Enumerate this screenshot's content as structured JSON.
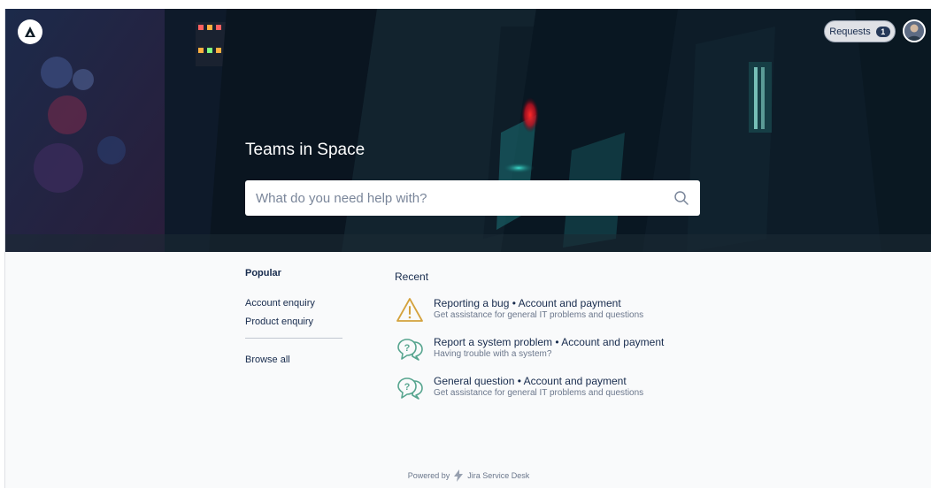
{
  "header": {
    "requests_label": "Requests",
    "requests_count": "1"
  },
  "hero": {
    "title": "Teams in Space",
    "search_placeholder": "What do you need help with?"
  },
  "popular": {
    "heading": "Popular",
    "links": [
      "Account enquiry",
      "Product enquiry"
    ],
    "browse_all": "Browse all"
  },
  "recent": {
    "heading": "Recent",
    "items": [
      {
        "title": "Reporting a bug • Account and payment",
        "description": "Get assistance for general IT problems and questions",
        "icon": "warning-icon"
      },
      {
        "title": "Report a system problem • Account and payment",
        "description": "Having trouble with a system?",
        "icon": "question-bubble-icon"
      },
      {
        "title": "General question • Account and payment",
        "description": "Get assistance for general IT problems and questions",
        "icon": "question-bubble-icon"
      }
    ]
  },
  "footer": {
    "powered_by": "Powered by",
    "product": "Jira Service Desk"
  },
  "colors": {
    "warning": "#d4a23c",
    "question": "#57a58f",
    "hero_dark": "#0a1620",
    "text": "#172b4d"
  }
}
